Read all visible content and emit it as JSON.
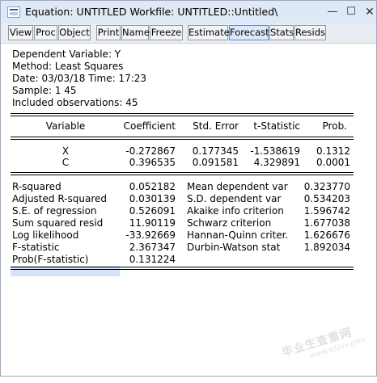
{
  "window": {
    "title": "Equation: UNTITLED   Workfile: UNTITLED::Untitled\\",
    "min_glyph": "—",
    "max_glyph": "☐",
    "close_glyph": "✕"
  },
  "toolbar": {
    "buttons": [
      "View",
      "Proc",
      "Object",
      "Print",
      "Name",
      "Freeze",
      "Estimate",
      "Forecast",
      "Stats",
      "Resids"
    ],
    "active": "Forecast"
  },
  "header": {
    "dependent": "Dependent Variable: Y",
    "method": "Method: Least Squares",
    "date": "Date: 03/03/18   Time: 17:23",
    "sample": "Sample: 1 45",
    "observations": "Included observations: 45"
  },
  "coef_table": {
    "headers": [
      "Variable",
      "Coefficient",
      "Std. Error",
      "t-Statistic",
      "Prob."
    ],
    "rows": [
      [
        "X",
        "-0.272867",
        "0.177345",
        "-1.538619",
        "0.1312"
      ],
      [
        "C",
        "0.396535",
        "0.091581",
        "4.329891",
        "0.0001"
      ]
    ]
  },
  "stats": {
    "left": [
      [
        "R-squared",
        "0.052182"
      ],
      [
        "Adjusted R-squared",
        "0.030139"
      ],
      [
        "S.E. of regression",
        "0.526091"
      ],
      [
        "Sum squared resid",
        "11.90119"
      ],
      [
        "Log likelihood",
        "-33.92669"
      ],
      [
        "F-statistic",
        "2.367347"
      ],
      [
        "Prob(F-statistic)",
        "0.131224"
      ]
    ],
    "right": [
      [
        "Mean dependent var",
        "0.323770"
      ],
      [
        "S.D. dependent var",
        "0.534203"
      ],
      [
        "Akaike info criterion",
        "1.596742"
      ],
      [
        "Schwarz criterion",
        "1.677038"
      ],
      [
        "Hannan-Quinn criter.",
        "1.626676"
      ],
      [
        "Durbin-Watson stat",
        "1.892034"
      ]
    ]
  },
  "watermark": {
    "line1": "毕业生查重网",
    "line2": "www.sdsvv.com"
  }
}
